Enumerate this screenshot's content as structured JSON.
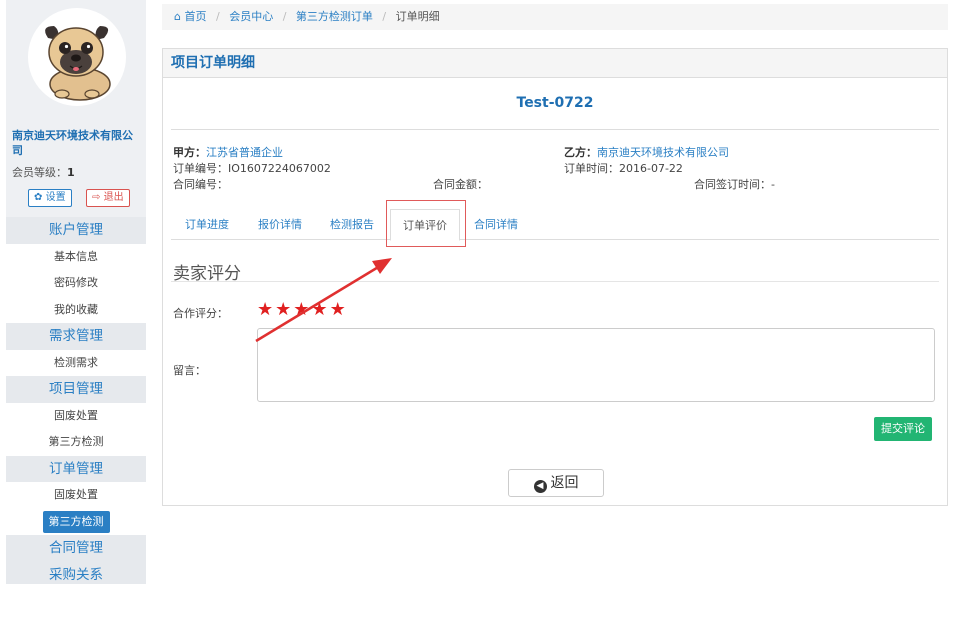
{
  "sidebar": {
    "company_name": "南京迪天环境技术有限公司",
    "member_level_label": "会员等级：",
    "member_level_value": "1",
    "settings_label": "设置",
    "logout_label": "退出",
    "nav": [
      {
        "type": "group",
        "label": "账户管理"
      },
      {
        "type": "item",
        "label": "基本信息"
      },
      {
        "type": "item",
        "label": "密码修改"
      },
      {
        "type": "item",
        "label": "我的收藏"
      },
      {
        "type": "group",
        "label": "需求管理"
      },
      {
        "type": "item",
        "label": "检测需求"
      },
      {
        "type": "group",
        "label": "项目管理"
      },
      {
        "type": "item",
        "label": "固废处置"
      },
      {
        "type": "item",
        "label": "第三方检测"
      },
      {
        "type": "group",
        "label": "订单管理"
      },
      {
        "type": "item",
        "label": "固废处置"
      },
      {
        "type": "item",
        "label": "第三方检测",
        "active": true
      },
      {
        "type": "group",
        "label": "合同管理"
      },
      {
        "type": "group",
        "label": "采购关系"
      }
    ]
  },
  "breadcrumb": {
    "home": "首页",
    "member_center": "会员中心",
    "orders": "第三方检测订单",
    "current": "订单明细"
  },
  "panel": {
    "heading": "项目订单明细",
    "project_title": "Test-0722",
    "party_a_label": "甲方：",
    "party_a_value": "江苏省普通企业",
    "party_b_label": "乙方：",
    "party_b_value": "南京迪天环境技术有限公司",
    "order_no_label": "订单编号：",
    "order_no_value": "IO1607224067002",
    "order_time_label": "订单时间：",
    "order_time_value": "2016-07-22",
    "contract_no_label": "合同编号：",
    "contract_no_value": "",
    "contract_amount_label": "合同金额：",
    "contract_amount_value": "",
    "contract_sign_label": "合同签订时间：",
    "contract_sign_value": "-"
  },
  "tabs": [
    {
      "label": "订单进度",
      "active": false
    },
    {
      "label": "报价详情",
      "active": false
    },
    {
      "label": "检测报告",
      "active": false
    },
    {
      "label": "订单评价",
      "active": true
    },
    {
      "label": "合同详情",
      "active": false
    }
  ],
  "review": {
    "section_title": "卖家评分",
    "rating_label": "合作评分：",
    "rating": 5,
    "rating_max": 5,
    "comment_label": "留言：",
    "comment_value": "",
    "submit_label": "提交评论"
  },
  "back_label": "返回",
  "colors": {
    "brand_blue": "#2a7fc4",
    "submit_green": "#22b573",
    "star_red": "#e02020",
    "annotation_red": "#e05a5a"
  }
}
